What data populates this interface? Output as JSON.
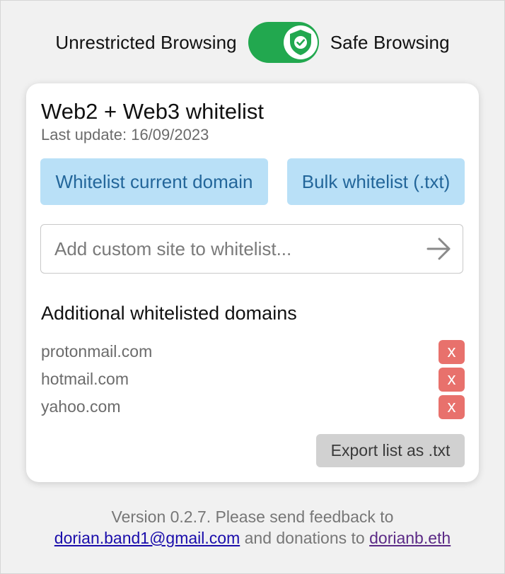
{
  "toggle": {
    "left_label": "Unrestricted Browsing",
    "right_label": "Safe Browsing",
    "state": "on",
    "icon": "shield-check-icon"
  },
  "card": {
    "title": "Web2 + Web3 whitelist",
    "last_update": "Last update: 16/09/2023",
    "whitelist_current_label": "Whitelist current domain",
    "bulk_whitelist_label": "Bulk whitelist (.txt)",
    "custom_site_placeholder": "Add custom site to whitelist...",
    "custom_site_value": "",
    "additional_heading": "Additional whitelisted domains",
    "domains": [
      {
        "name": "protonmail.com",
        "remove_label": "x"
      },
      {
        "name": "hotmail.com",
        "remove_label": "x"
      },
      {
        "name": "yahoo.com",
        "remove_label": "x"
      }
    ],
    "export_label": "Export list as .txt"
  },
  "footer": {
    "version_text": "Version 0.2.7. Please send feedback to",
    "email": "dorian.band1@gmail.com",
    "donations_text": "and donations to",
    "eth_name": "dorianb.eth"
  },
  "colors": {
    "toggle_on": "#22a84f",
    "button_blue_bg": "#b9e0f7",
    "button_blue_text": "#23669a",
    "remove_red": "#e8716c",
    "export_gray": "#d1d1d1"
  }
}
